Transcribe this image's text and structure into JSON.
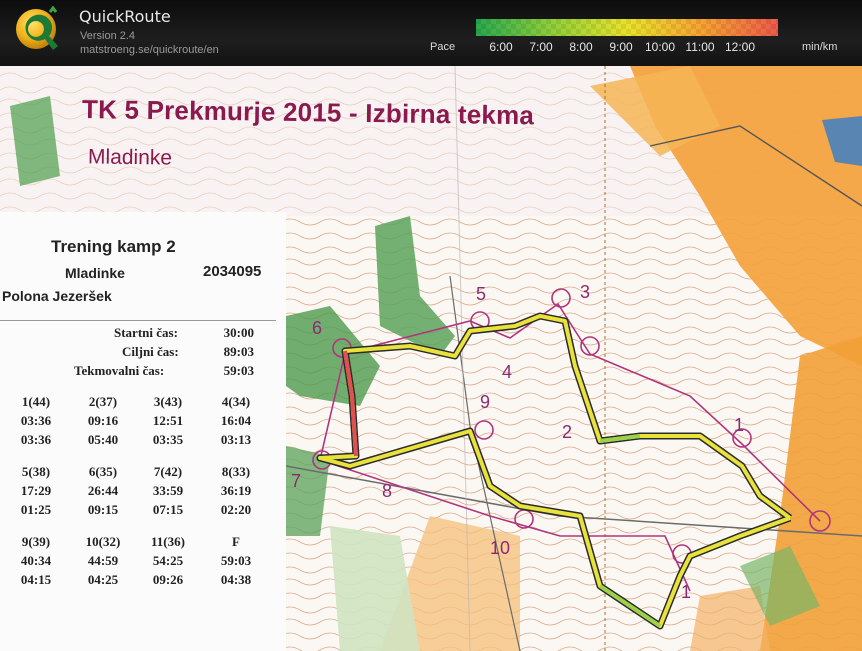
{
  "app": {
    "name": "QuickRoute",
    "version": "Version 2.4",
    "url": "matstroeng.se/quickroute/en",
    "pace_label": "Pace",
    "pace_ticks": [
      "6:00",
      "7:00",
      "8:00",
      "9:00",
      "10:00",
      "11:00",
      "12:00"
    ],
    "pace_unit": "min/km",
    "pace_colors": [
      "#27a84f",
      "#8fcf3a",
      "#e9e32a",
      "#f6a233",
      "#ef5a4a"
    ]
  },
  "map": {
    "title": "TK 5 Prekmurje 2015 - Izbirna tekma",
    "subtitle": "Mladinke",
    "control_numbers": [
      "5",
      "3",
      "6",
      "4",
      "9",
      "2",
      "1",
      "7",
      "8",
      "10",
      "1"
    ],
    "colors": {
      "course": "#b0357c",
      "route_track": "#e8e23a",
      "route_edge": "#2b2b2b",
      "route_slow": "#e05050",
      "open_land": "#f4a23c",
      "forest_green": "#5aa35a"
    }
  },
  "slip": {
    "event": "Trening kamp 2",
    "category": "Mladinke",
    "si_number": "2034095",
    "runner": "Polona Jezeršek",
    "start_label": "Startni čas:",
    "start_value": "30:00",
    "finish_label": "Ciljni čas:",
    "finish_value": "89:03",
    "total_label": "Tekmovalni čas:",
    "total_value": "59:03",
    "splits": [
      {
        "code": "1(44)",
        "elapsed": "03:36",
        "leg": "03:36"
      },
      {
        "code": "2(37)",
        "elapsed": "09:16",
        "leg": "05:40"
      },
      {
        "code": "3(43)",
        "elapsed": "12:51",
        "leg": "03:35"
      },
      {
        "code": "4(34)",
        "elapsed": "16:04",
        "leg": "03:13"
      },
      {
        "code": "5(38)",
        "elapsed": "17:29",
        "leg": "01:25"
      },
      {
        "code": "6(35)",
        "elapsed": "26:44",
        "leg": "09:15"
      },
      {
        "code": "7(42)",
        "elapsed": "33:59",
        "leg": "07:15"
      },
      {
        "code": "8(33)",
        "elapsed": "36:19",
        "leg": "02:20"
      },
      {
        "code": "9(39)",
        "elapsed": "40:34",
        "leg": "04:15"
      },
      {
        "code": "10(32)",
        "elapsed": "44:59",
        "leg": "04:25"
      },
      {
        "code": "11(36)",
        "elapsed": "54:25",
        "leg": "09:26"
      },
      {
        "code": "F",
        "elapsed": "59:03",
        "leg": "04:38"
      }
    ]
  }
}
